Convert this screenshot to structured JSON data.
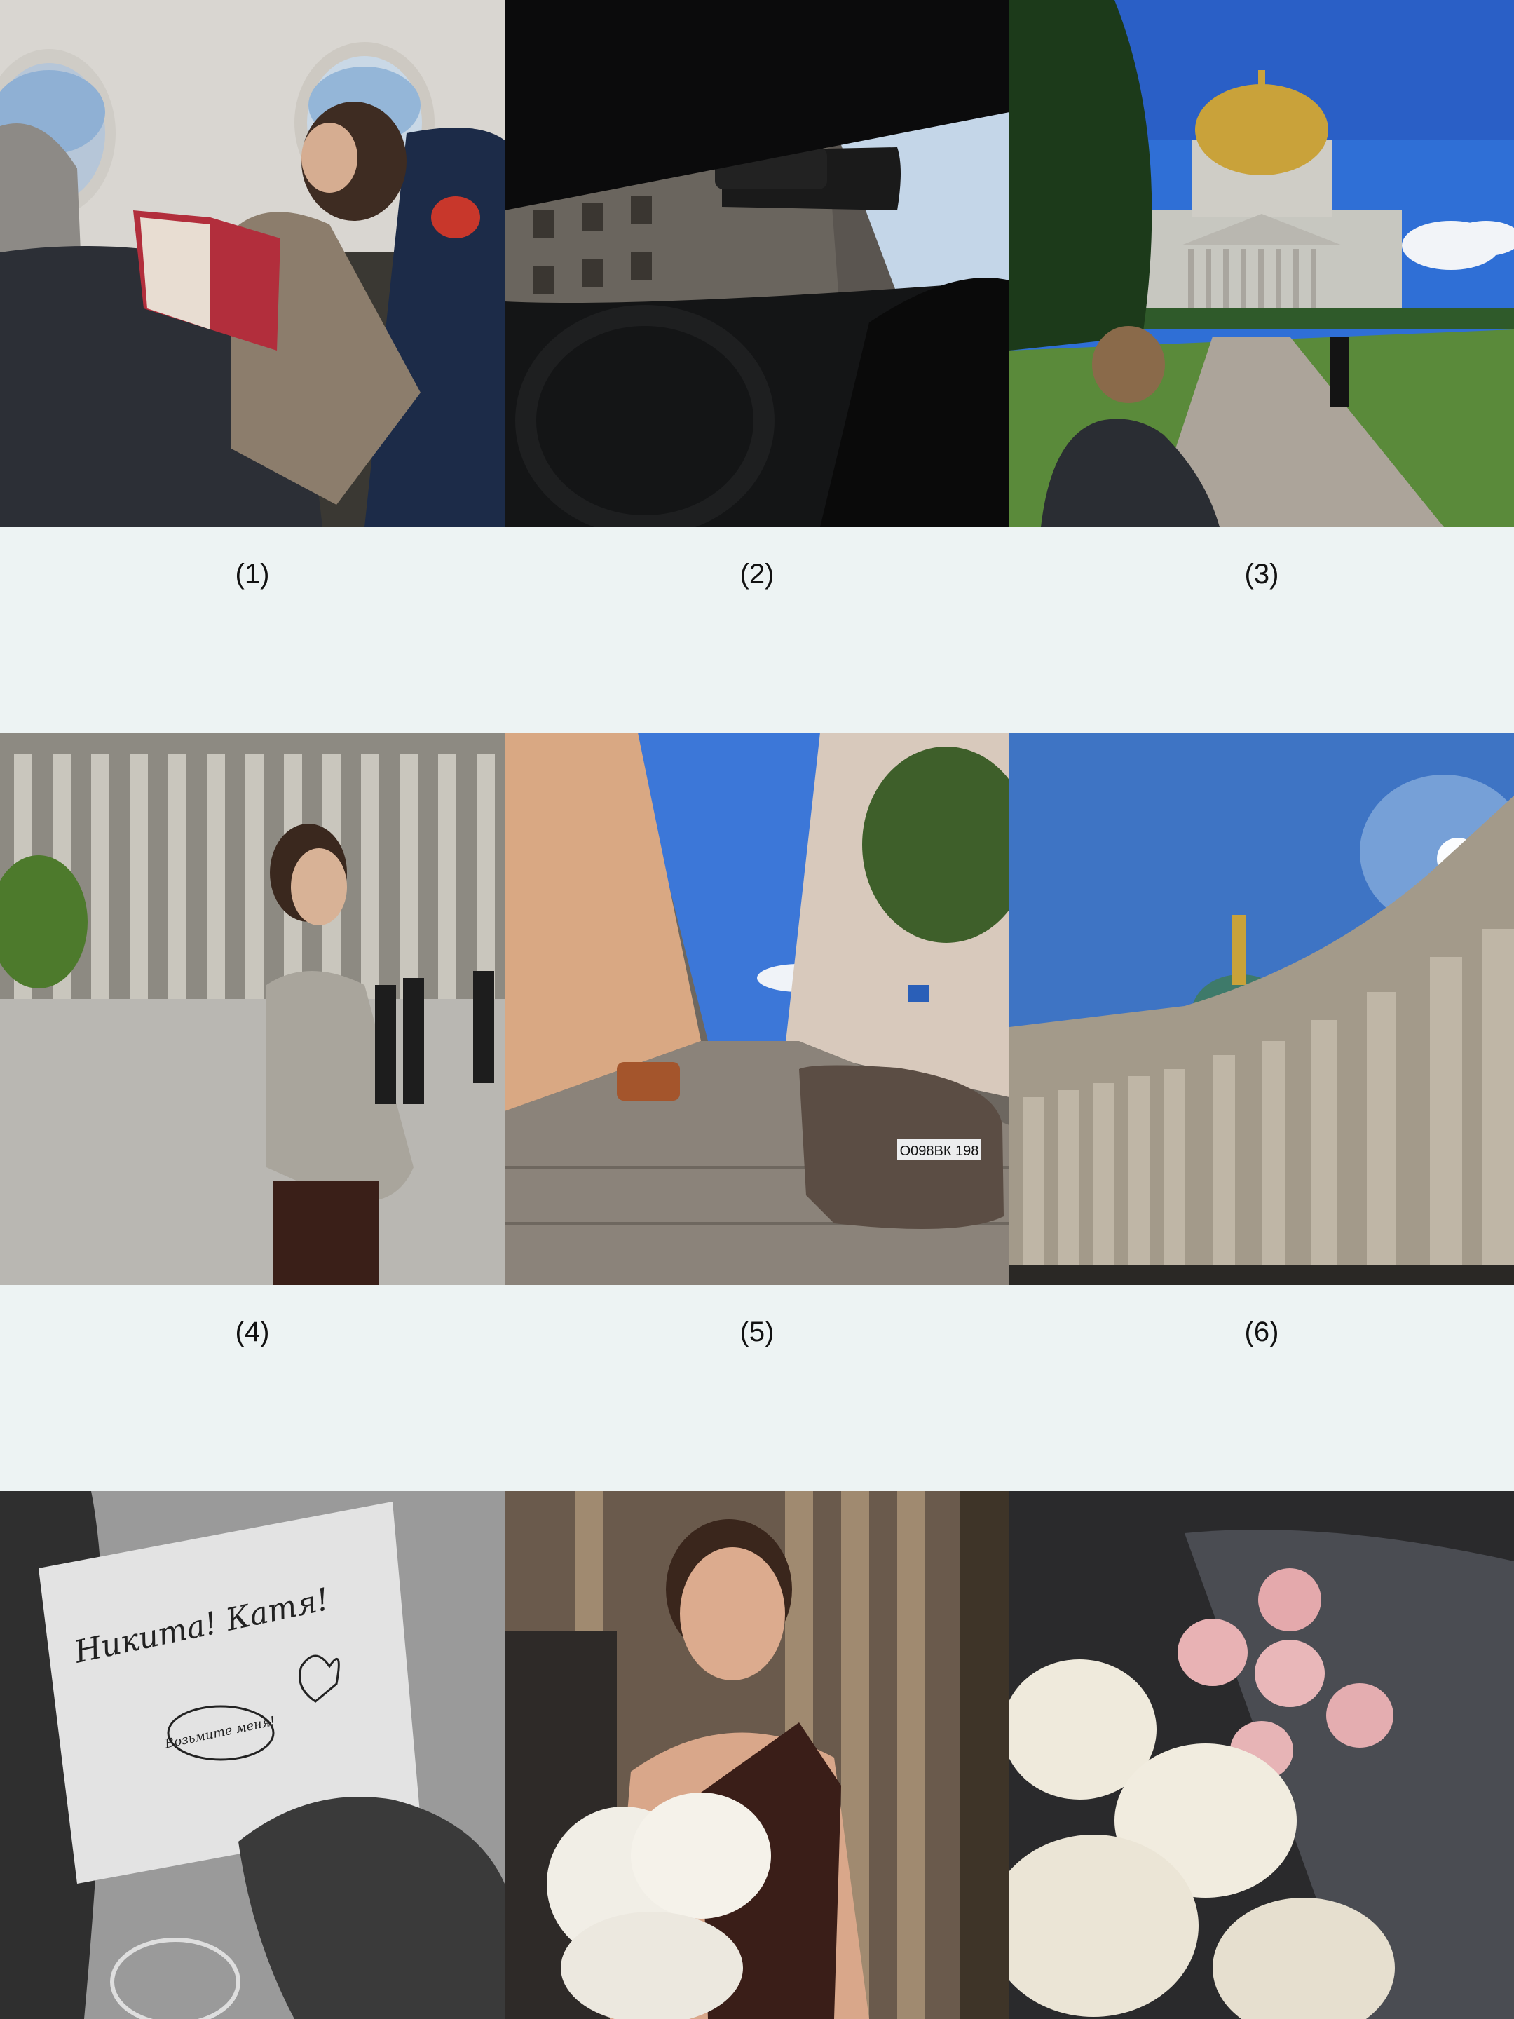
{
  "captions": [
    "(1)",
    "(2)",
    "(3)",
    "(4)",
    "(5)",
    "(6)"
  ],
  "photos": [
    {
      "subject": "Woman reading a book by an airplane window"
    },
    {
      "subject": "View from inside a car onto a city street"
    },
    {
      "subject": "St. Isaac's Cathedral with golden dome"
    },
    {
      "subject": "Woman standing in front of cathedral colonnade"
    },
    {
      "subject": "Cobblestone street with parked cars"
    },
    {
      "subject": "Kazan Cathedral colonnade from below"
    },
    {
      "subject": "Black and white hand-drawn card held in hand",
      "card_text": "Никита! Катя!",
      "bubble_text": "Возьмите меня!"
    },
    {
      "subject": "Smiling woman holding white peonies"
    },
    {
      "subject": "Bouquets of white and pink roses"
    }
  ],
  "plates": {
    "p5": "О098ВК 198"
  }
}
